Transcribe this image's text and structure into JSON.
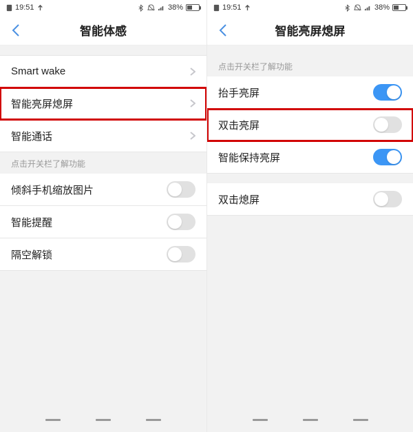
{
  "statusbar": {
    "time": "19:51",
    "battery_pct": "38%"
  },
  "left_screen": {
    "title": "智能体感",
    "rows_nav": [
      {
        "label": "Smart wake"
      },
      {
        "label": "智能亮屏熄屏",
        "highlighted": true
      },
      {
        "label": "智能通话"
      }
    ],
    "hint": "点击开关栏了解功能",
    "rows_toggle": [
      {
        "label": "倾斜手机缩放图片",
        "on": false
      },
      {
        "label": "智能提醒",
        "on": false
      },
      {
        "label": "隔空解锁",
        "on": false
      }
    ]
  },
  "right_screen": {
    "title": "智能亮屏熄屏",
    "hint": "点击开关栏了解功能",
    "group1": [
      {
        "label": "抬手亮屏",
        "on": true
      },
      {
        "label": "双击亮屏",
        "on": false,
        "highlighted": true
      },
      {
        "label": "智能保持亮屏",
        "on": true
      }
    ],
    "group2": [
      {
        "label": "双击熄屏",
        "on": false
      }
    ]
  }
}
